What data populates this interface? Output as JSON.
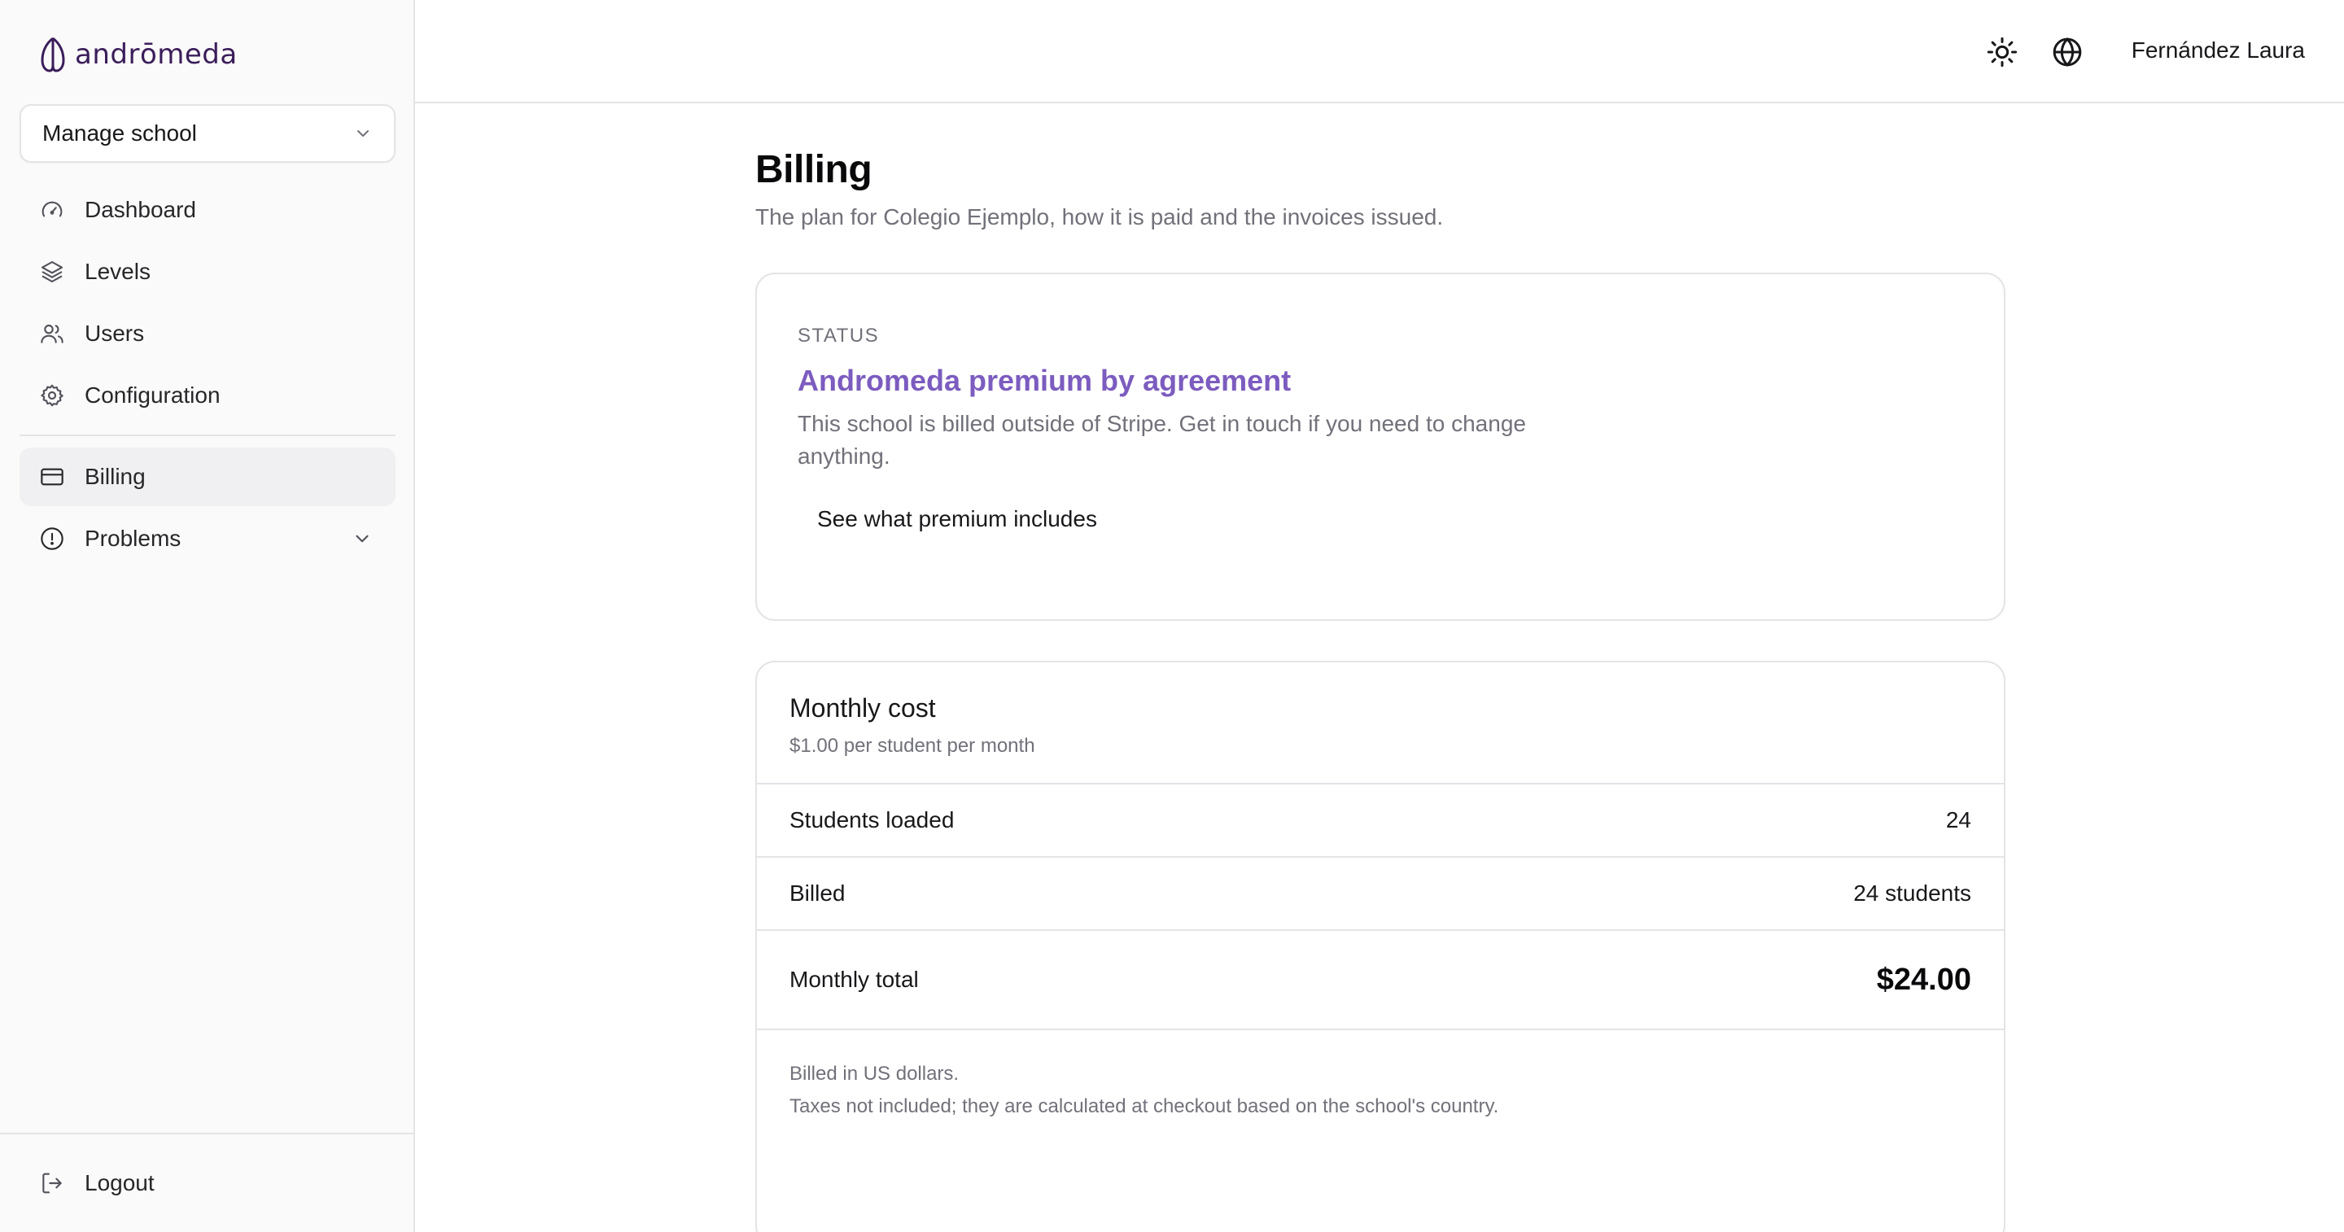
{
  "app": {
    "brand_name": "andrōmeda"
  },
  "sidebar": {
    "school_select": {
      "label": "Manage school"
    },
    "items": [
      {
        "label": "Dashboard"
      },
      {
        "label": "Levels"
      },
      {
        "label": "Users"
      },
      {
        "label": "Configuration"
      },
      {
        "label": "Billing"
      },
      {
        "label": "Problems"
      }
    ],
    "logout_label": "Logout",
    "active_item": "Billing"
  },
  "header": {
    "user_name": "Fernández Laura"
  },
  "page": {
    "title": "Billing",
    "subtitle": "The plan for Colegio Ejemplo, how it is paid and the invoices issued."
  },
  "status_card": {
    "eyebrow": "STATUS",
    "plan_title": "Andromeda premium by agreement",
    "description": "This school is billed outside of Stripe. Get in touch if you need to change anything.",
    "button_label": "See what premium includes"
  },
  "cost_card": {
    "title": "Monthly cost",
    "subtitle": "$1.00 per student per month",
    "rows": [
      {
        "label": "Students loaded",
        "value": "24"
      },
      {
        "label": "Billed",
        "value": "24 students"
      },
      {
        "label": "Monthly total",
        "value": "$24.00"
      }
    ],
    "notes": [
      "Billed in US dollars.",
      "Taxes not included; they are calculated at checkout based on the school's country."
    ]
  },
  "colors": {
    "accent": "#7c5cbf",
    "brand": "#3b1d5a",
    "muted_text": "#71717a",
    "border": "#e4e4e7",
    "sidebar_bg": "#fafafa"
  }
}
